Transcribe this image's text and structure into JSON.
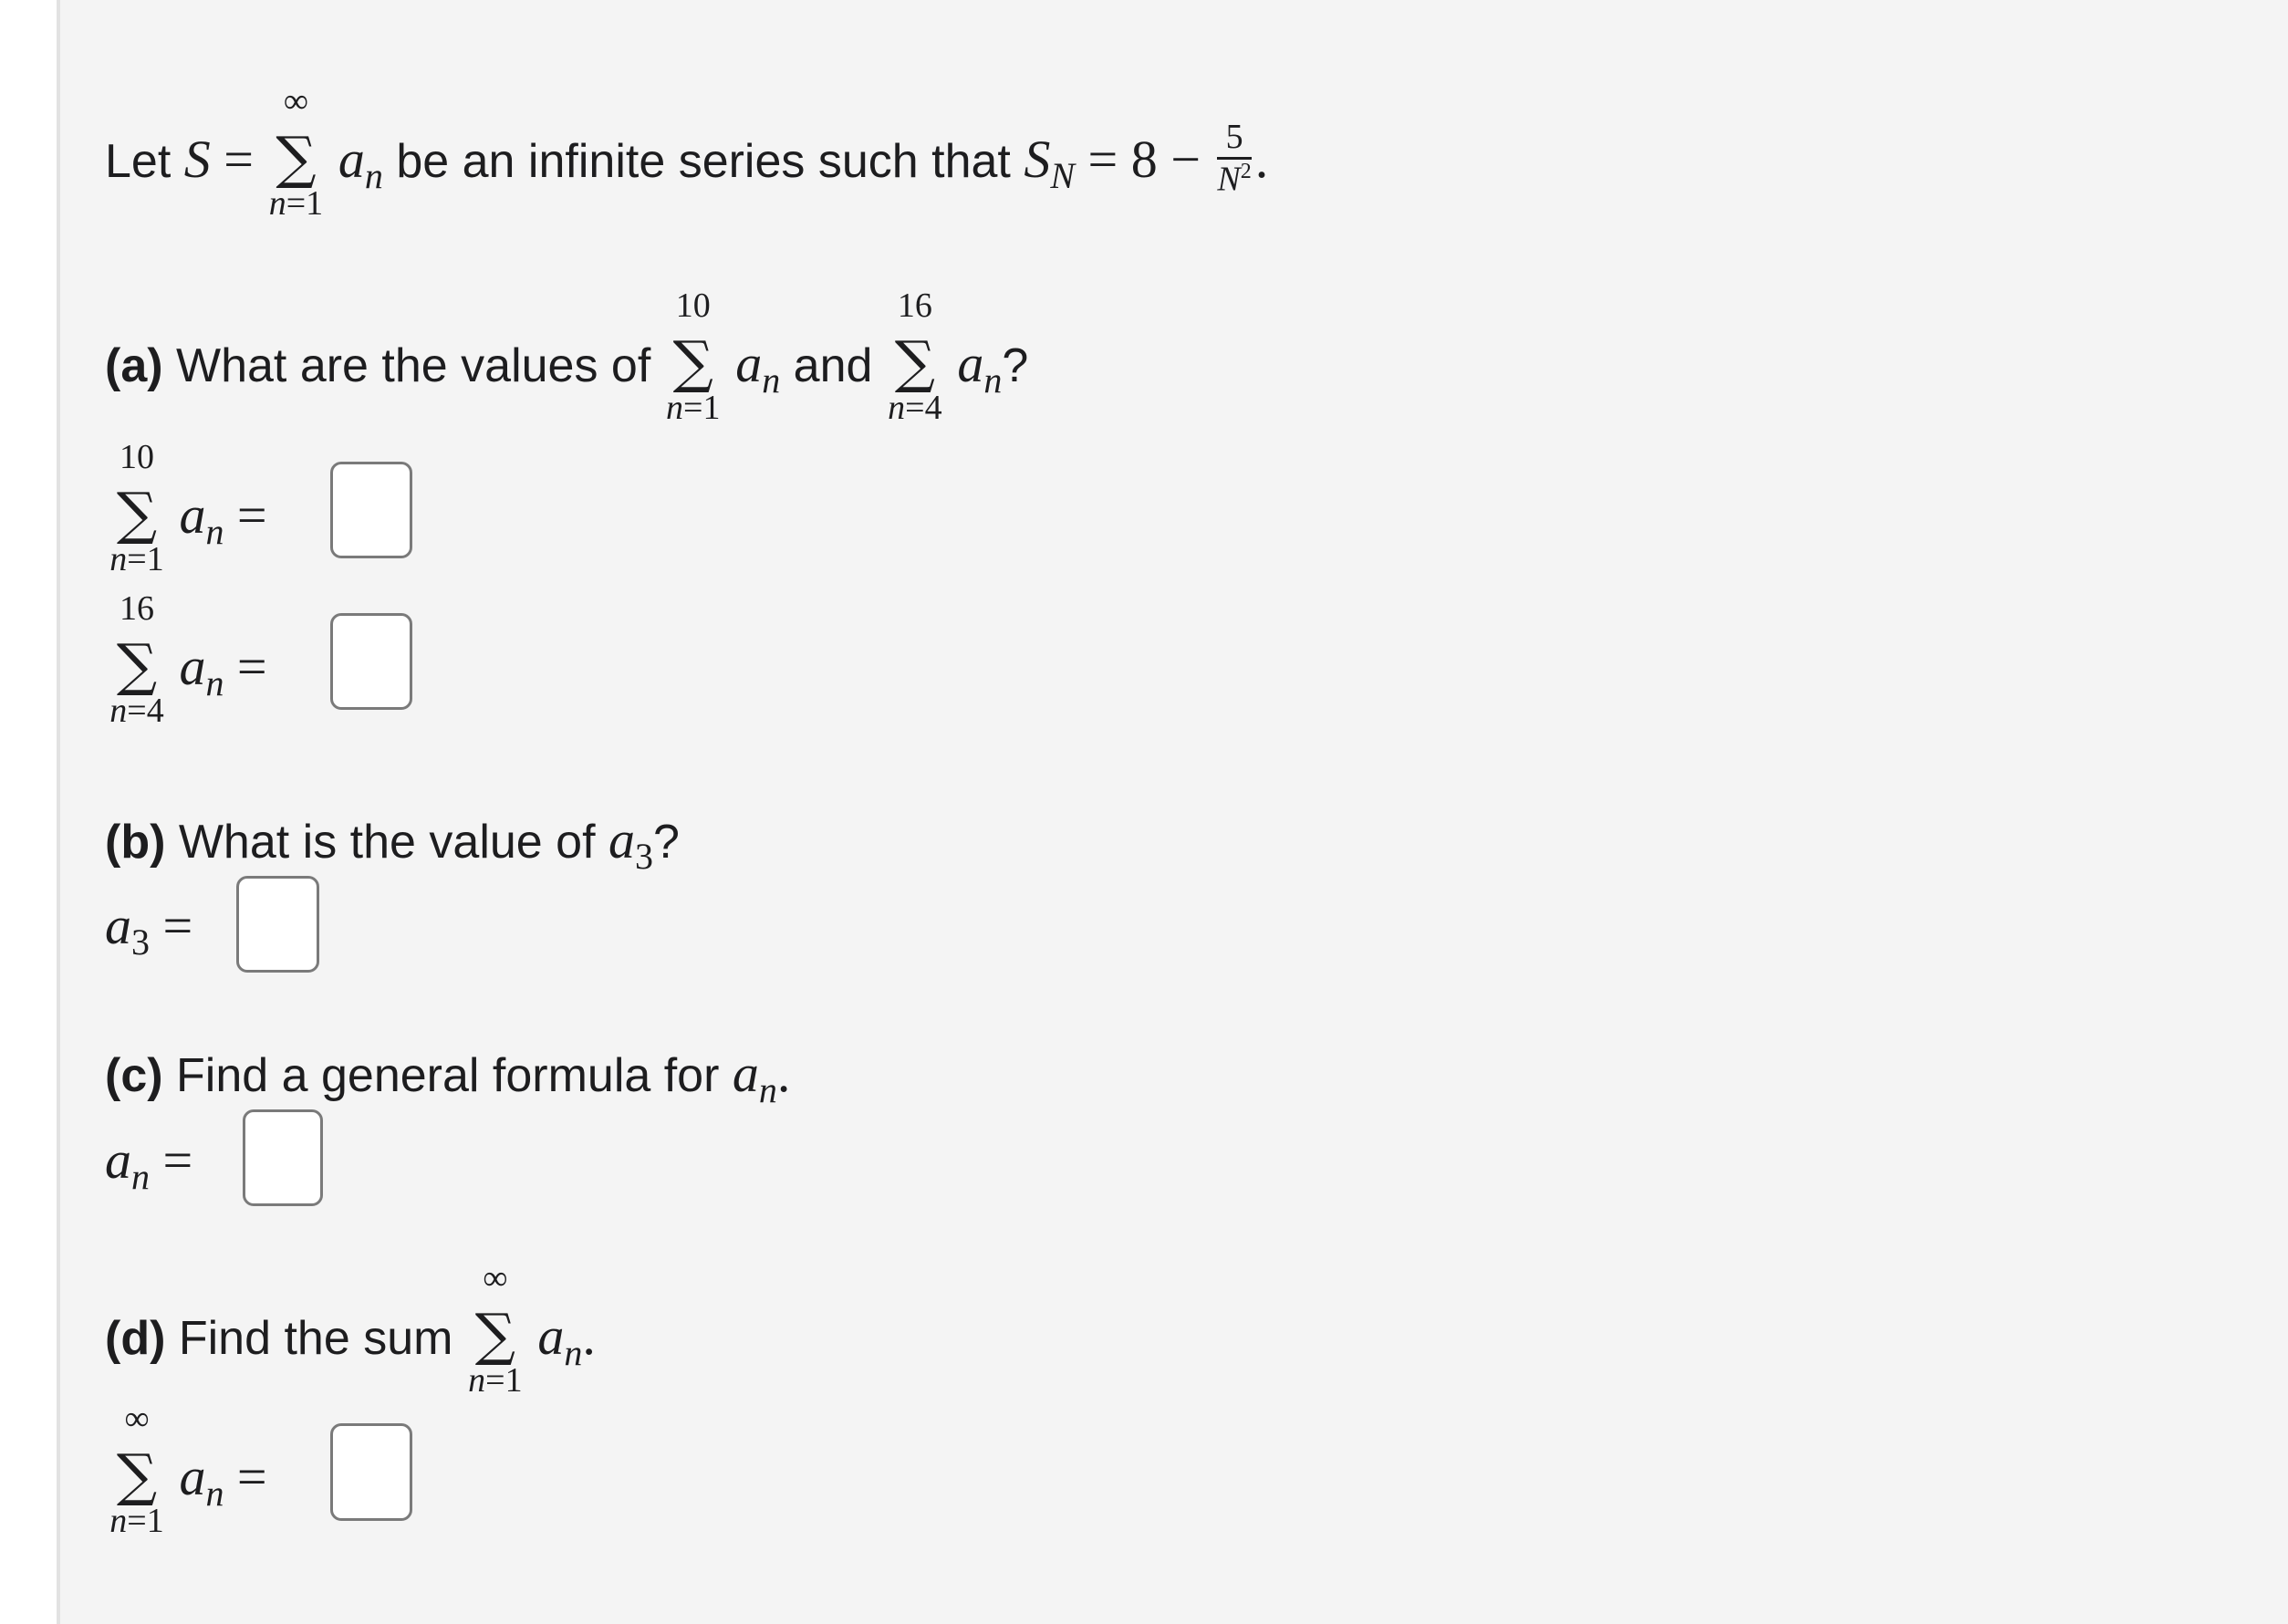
{
  "intro": {
    "prefix": "Let ",
    "S": "S",
    "eq": " = ",
    "sum_upper": "∞",
    "sum_lower_var": "n",
    "sum_lower_val": "=1",
    "term": "a",
    "term_sub": "n",
    "middle": " be an infinite series such that ",
    "SN": "S",
    "SN_sub": "N",
    "rhs": " = 8 − ",
    "frac_num": "5",
    "frac_den": "N",
    "frac_den_exp": "2",
    "end": "."
  },
  "part_a": {
    "label": "(a)",
    "text": " What are the values of ",
    "sum1_upper": "10",
    "sum1_lower": "=1",
    "and": " and ",
    "sum2_upper": "16",
    "sum2_lower": "=4",
    "end": "?",
    "answer1": {
      "upper": "10",
      "lower": "=1",
      "value": ""
    },
    "answer2": {
      "upper": "16",
      "lower": "=4",
      "value": ""
    }
  },
  "part_b": {
    "label": "(b)",
    "text": " What is the value of ",
    "var": "a",
    "var_sub": "3",
    "end": "?",
    "answer": {
      "value": ""
    }
  },
  "part_c": {
    "label": "(c)",
    "text": " Find a general formula for ",
    "var": "a",
    "var_sub": "n",
    "end": ".",
    "answer": {
      "value": ""
    }
  },
  "part_d": {
    "label": "(d)",
    "text": " Find the sum ",
    "sum_upper": "∞",
    "sum_lower": "=1",
    "end": ".",
    "answer": {
      "upper": "∞",
      "lower": "=1",
      "value": ""
    }
  },
  "symbols": {
    "sigma": "∑",
    "equals": "=",
    "n": "n",
    "a": "a"
  }
}
